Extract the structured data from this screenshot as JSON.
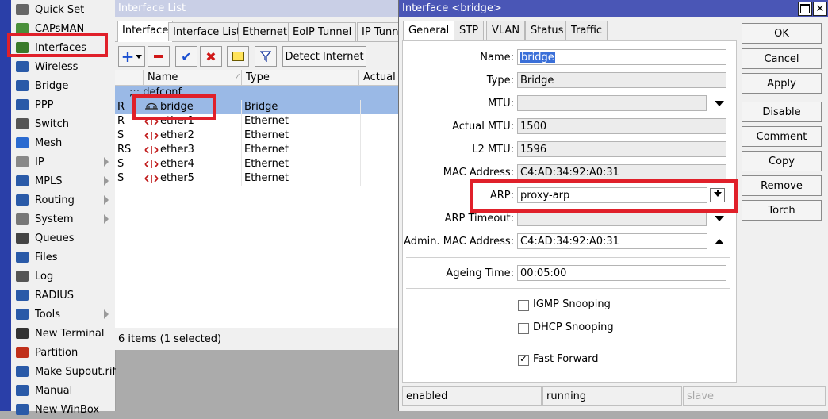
{
  "nav": {
    "items": [
      {
        "label": "Quick Set",
        "icon": "quick-set-icon",
        "arrow": false
      },
      {
        "label": "CAPsMAN",
        "icon": "capsman-icon",
        "arrow": false
      },
      {
        "label": "Interfaces",
        "icon": "interfaces-icon",
        "arrow": false
      },
      {
        "label": "Wireless",
        "icon": "wireless-icon",
        "arrow": false
      },
      {
        "label": "Bridge",
        "icon": "bridge-icon",
        "arrow": false
      },
      {
        "label": "PPP",
        "icon": "ppp-icon",
        "arrow": false
      },
      {
        "label": "Switch",
        "icon": "switch-icon",
        "arrow": false
      },
      {
        "label": "Mesh",
        "icon": "mesh-icon",
        "arrow": false
      },
      {
        "label": "IP",
        "icon": "ip-icon",
        "arrow": true
      },
      {
        "label": "MPLS",
        "icon": "mpls-icon",
        "arrow": true
      },
      {
        "label": "Routing",
        "icon": "routing-icon",
        "arrow": true
      },
      {
        "label": "System",
        "icon": "system-icon",
        "arrow": true
      },
      {
        "label": "Queues",
        "icon": "queues-icon",
        "arrow": false
      },
      {
        "label": "Files",
        "icon": "files-icon",
        "arrow": false
      },
      {
        "label": "Log",
        "icon": "log-icon",
        "arrow": false
      },
      {
        "label": "RADIUS",
        "icon": "radius-icon",
        "arrow": false
      },
      {
        "label": "Tools",
        "icon": "tools-icon",
        "arrow": true
      },
      {
        "label": "New Terminal",
        "icon": "terminal-icon",
        "arrow": false
      },
      {
        "label": "Partition",
        "icon": "partition-icon",
        "arrow": false
      },
      {
        "label": "Make Supout.rif",
        "icon": "supout-icon",
        "arrow": false
      },
      {
        "label": "Manual",
        "icon": "manual-icon",
        "arrow": false
      },
      {
        "label": "New WinBox",
        "icon": "winbox-icon",
        "arrow": false
      }
    ]
  },
  "iflist": {
    "title": "Interface List",
    "tabs": [
      "Interface",
      "Interface List",
      "Ethernet",
      "EoIP Tunnel",
      "IP Tunn"
    ],
    "toolbar": {
      "detect_label": "Detect Internet"
    },
    "columns": {
      "name": "Name",
      "type": "Type",
      "actual": "Actual M"
    },
    "group_comment": ";;; defconf",
    "rows": [
      {
        "flag": "R",
        "name": "bridge",
        "type": "Bridge",
        "icon": "bridge-icon"
      },
      {
        "flag": "R",
        "name": "ether1",
        "type": "Ethernet",
        "icon": "ethernet-icon"
      },
      {
        "flag": "S",
        "name": "ether2",
        "type": "Ethernet",
        "icon": "ethernet-icon"
      },
      {
        "flag": "RS",
        "name": "ether3",
        "type": "Ethernet",
        "icon": "ethernet-icon"
      },
      {
        "flag": "S",
        "name": "ether4",
        "type": "Ethernet",
        "icon": "ethernet-icon"
      },
      {
        "flag": "S",
        "name": "ether5",
        "type": "Ethernet",
        "icon": "ethernet-icon"
      }
    ],
    "status": "6 items (1 selected)"
  },
  "dialog": {
    "title": "Interface <bridge>",
    "tabs": [
      "General",
      "STP",
      "VLAN",
      "Status",
      "Traffic"
    ],
    "fields": {
      "name": {
        "label": "Name:",
        "value": "bridge"
      },
      "type": {
        "label": "Type:",
        "value": "Bridge"
      },
      "mtu": {
        "label": "MTU:",
        "value": ""
      },
      "actual_mtu": {
        "label": "Actual MTU:",
        "value": "1500"
      },
      "l2_mtu": {
        "label": "L2 MTU:",
        "value": "1596"
      },
      "mac": {
        "label": "MAC Address:",
        "value": "C4:AD:34:92:A0:31"
      },
      "arp": {
        "label": "ARP:",
        "value": "proxy-arp"
      },
      "arp_timeout": {
        "label": "ARP Timeout:",
        "value": ""
      },
      "admin_mac": {
        "label": "Admin. MAC Address:",
        "value": "C4:AD:34:92:A0:31"
      },
      "ageing": {
        "label": "Ageing Time:",
        "value": "00:05:00"
      }
    },
    "checkboxes": {
      "igmp": {
        "label": "IGMP Snooping",
        "checked": false
      },
      "dhcp": {
        "label": "DHCP Snooping",
        "checked": false
      },
      "fast": {
        "label": "Fast Forward",
        "checked": true
      }
    },
    "buttons": [
      "OK",
      "Cancel",
      "Apply",
      "Disable",
      "Comment",
      "Copy",
      "Remove",
      "Torch"
    ],
    "status": [
      "enabled",
      "running",
      "slave"
    ]
  }
}
